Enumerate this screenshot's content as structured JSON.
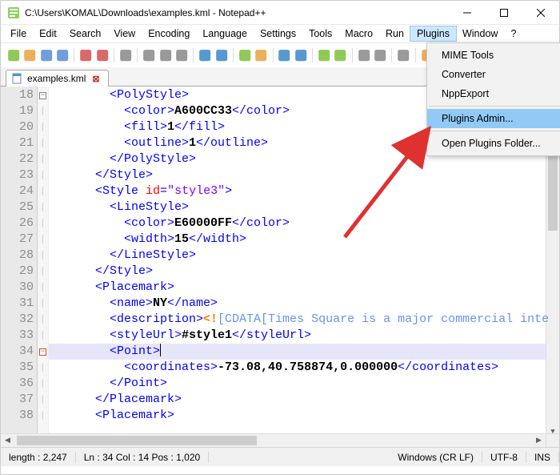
{
  "window": {
    "title": "C:\\Users\\KOMAL\\Downloads\\examples.kml - Notepad++"
  },
  "menubar": [
    "File",
    "Edit",
    "Search",
    "View",
    "Encoding",
    "Language",
    "Settings",
    "Tools",
    "Macro",
    "Run",
    "Plugins",
    "Window",
    "?"
  ],
  "active_menu_index": 10,
  "dropdown": {
    "items": [
      "MIME Tools",
      "Converter",
      "NppExport",
      "Plugins Admin...",
      "Open Plugins Folder..."
    ],
    "separators_after": [
      2,
      3
    ],
    "highlighted_index": 3
  },
  "tabs": [
    {
      "label": "examples.kml"
    }
  ],
  "gutter_start": 18,
  "gutter_count": 21,
  "current_line_index": 16,
  "fold_markers": {
    "0": "minus",
    "16": "minus-red"
  },
  "code_lines": [
    [
      {
        "c": "t",
        "t": "        <PolyStyle>"
      }
    ],
    [
      {
        "c": "t",
        "t": "          <color>"
      },
      {
        "c": "bk",
        "t": "A600CC33"
      },
      {
        "c": "t",
        "t": "</color>"
      }
    ],
    [
      {
        "c": "t",
        "t": "          <fill>"
      },
      {
        "c": "bk",
        "t": "1"
      },
      {
        "c": "t",
        "t": "</fill>"
      }
    ],
    [
      {
        "c": "t",
        "t": "          <outline>"
      },
      {
        "c": "bk",
        "t": "1"
      },
      {
        "c": "t",
        "t": "</outline>"
      }
    ],
    [
      {
        "c": "t",
        "t": "        </PolyStyle>"
      }
    ],
    [
      {
        "c": "t",
        "t": "      </Style>"
      }
    ],
    [
      {
        "c": "t",
        "t": "      <Style "
      },
      {
        "c": "at",
        "t": "id"
      },
      {
        "c": "t",
        "t": "="
      },
      {
        "c": "st",
        "t": "\"style3\""
      },
      {
        "c": "t",
        "t": ">"
      }
    ],
    [
      {
        "c": "t",
        "t": "        <LineStyle>"
      }
    ],
    [
      {
        "c": "t",
        "t": "          <color>"
      },
      {
        "c": "bk",
        "t": "E60000FF"
      },
      {
        "c": "t",
        "t": "</color>"
      }
    ],
    [
      {
        "c": "t",
        "t": "          <width>"
      },
      {
        "c": "bk",
        "t": "15"
      },
      {
        "c": "t",
        "t": "</width>"
      }
    ],
    [
      {
        "c": "t",
        "t": "        </LineStyle>"
      }
    ],
    [
      {
        "c": "t",
        "t": "      </Style>"
      }
    ],
    [
      {
        "c": "t",
        "t": "      <Placemark>"
      }
    ],
    [
      {
        "c": "t",
        "t": "        <name>"
      },
      {
        "c": "bk",
        "t": "NY"
      },
      {
        "c": "t",
        "t": "</name>"
      }
    ],
    [
      {
        "c": "t",
        "t": "        <description>"
      },
      {
        "c": "pp",
        "t": "<!"
      },
      {
        "c": "cm",
        "t": "[CDATA[Times Square is a major commercial inte"
      }
    ],
    [
      {
        "c": "t",
        "t": "        <styleUrl>"
      },
      {
        "c": "bk",
        "t": "#style1"
      },
      {
        "c": "t",
        "t": "</styleUrl>"
      }
    ],
    [
      {
        "c": "t",
        "t": "        <Point>"
      },
      {
        "caret": true
      }
    ],
    [
      {
        "c": "t",
        "t": "          <coordinates>"
      },
      {
        "c": "bk",
        "t": "-73.08,40.758874,0.000000"
      },
      {
        "c": "t",
        "t": "</coordinates>"
      }
    ],
    [
      {
        "c": "t",
        "t": "        </Point>"
      }
    ],
    [
      {
        "c": "t",
        "t": "      </Placemark>"
      }
    ],
    [
      {
        "c": "t",
        "t": "      <Placemark>"
      }
    ]
  ],
  "statusbar": {
    "length": "length : 2,247",
    "pos": "Ln : 34   Col : 14   Pos : 1,020",
    "eol": "Windows (CR LF)",
    "enc": "UTF-8",
    "ins": "INS"
  },
  "toolbar_icons": [
    {
      "name": "new-file-icon",
      "color": "#7bbf3a"
    },
    {
      "name": "open-file-icon",
      "color": "#e8a33d"
    },
    {
      "name": "save-icon",
      "color": "#5b8bd4"
    },
    {
      "name": "save-all-icon",
      "color": "#5b8bd4"
    },
    {
      "sep": true
    },
    {
      "name": "close-icon",
      "color": "#d05050"
    },
    {
      "name": "close-all-icon",
      "color": "#d05050"
    },
    {
      "sep": true
    },
    {
      "name": "print-icon",
      "color": "#888"
    },
    {
      "sep": true
    },
    {
      "name": "cut-icon",
      "color": "#888"
    },
    {
      "name": "copy-icon",
      "color": "#888"
    },
    {
      "name": "paste-icon",
      "color": "#888"
    },
    {
      "sep": true
    },
    {
      "name": "undo-icon",
      "color": "#3a87c7"
    },
    {
      "name": "redo-icon",
      "color": "#3a87c7"
    },
    {
      "sep": true
    },
    {
      "name": "find-icon",
      "color": "#7bbf3a"
    },
    {
      "name": "replace-icon",
      "color": "#e8a33d"
    },
    {
      "sep": true
    },
    {
      "name": "zoom-in-icon",
      "color": "#3a87c7"
    },
    {
      "name": "zoom-out-icon",
      "color": "#3a87c7"
    },
    {
      "sep": true
    },
    {
      "name": "sync-v-icon",
      "color": "#7bbf3a"
    },
    {
      "name": "sync-h-icon",
      "color": "#7bbf3a"
    },
    {
      "sep": true
    },
    {
      "name": "wrap-icon",
      "color": "#888"
    },
    {
      "name": "chars-icon",
      "color": "#888"
    },
    {
      "sep": true
    },
    {
      "name": "indent-icon",
      "color": "#888"
    },
    {
      "sep": true
    },
    {
      "name": "folder-tree-icon",
      "color": "#e8a33d"
    },
    {
      "name": "doc-list-icon",
      "color": "#888"
    },
    {
      "name": "func-list-icon",
      "color": "#888"
    },
    {
      "sep": true
    },
    {
      "name": "doc-map-icon",
      "color": "#888"
    },
    {
      "sep": true
    },
    {
      "name": "monitor-icon",
      "color": "#888"
    },
    {
      "sep": true
    },
    {
      "name": "record-icon",
      "color": "#d05050"
    },
    {
      "name": "stop-icon",
      "color": "#888"
    }
  ]
}
